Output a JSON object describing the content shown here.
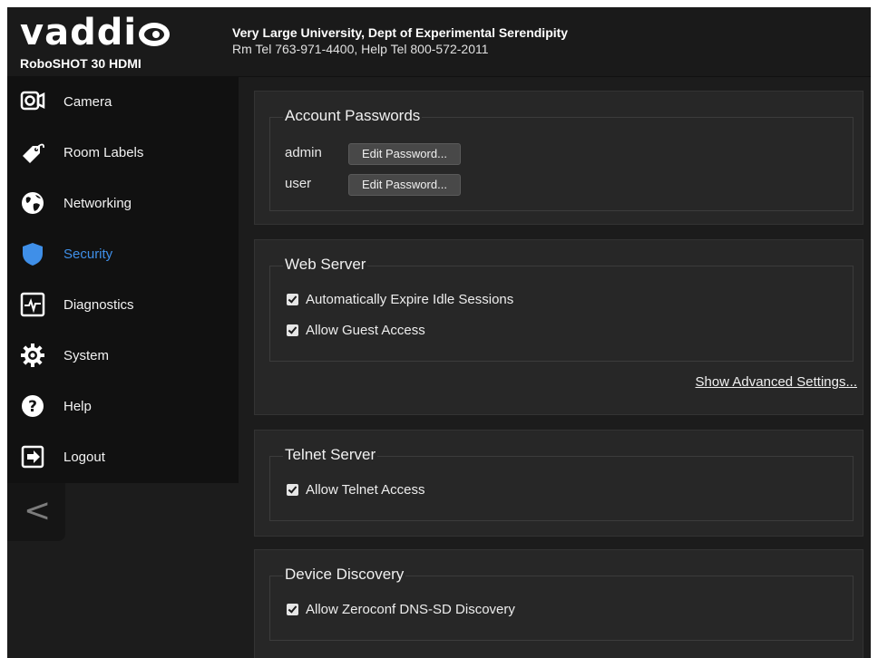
{
  "header": {
    "logo": "vaddio",
    "model": "RoboSHOT 30 HDMI",
    "org_name": "Very Large University, Dept of Experimental Serendipity",
    "phones": "Rm Tel 763-971-4400, Help Tel 800-572-2011"
  },
  "sidebar": {
    "items": [
      {
        "label": "Camera",
        "icon": "camera-icon"
      },
      {
        "label": "Room Labels",
        "icon": "tag-icon"
      },
      {
        "label": "Networking",
        "icon": "globe-icon"
      },
      {
        "label": "Security",
        "icon": "shield-icon",
        "active": true
      },
      {
        "label": "Diagnostics",
        "icon": "pulse-icon"
      },
      {
        "label": "System",
        "icon": "gear-icon"
      },
      {
        "label": "Help",
        "icon": "question-icon"
      },
      {
        "label": "Logout",
        "icon": "logout-icon"
      }
    ],
    "collapse_glyph": "<"
  },
  "account_passwords": {
    "title": "Account Passwords",
    "rows": [
      {
        "user": "admin",
        "button": "Edit Password..."
      },
      {
        "user": "user",
        "button": "Edit Password..."
      }
    ]
  },
  "web_server": {
    "title": "Web Server",
    "options": [
      {
        "label": "Automatically Expire Idle Sessions",
        "checked": true
      },
      {
        "label": "Allow Guest Access",
        "checked": true
      }
    ],
    "advanced_link": "Show Advanced Settings..."
  },
  "telnet_server": {
    "title": "Telnet Server",
    "options": [
      {
        "label": "Allow Telnet Access",
        "checked": true
      }
    ]
  },
  "device_discovery": {
    "title": "Device Discovery",
    "options": [
      {
        "label": "Allow Zeroconf DNS-SD Discovery",
        "checked": true
      }
    ]
  },
  "colors": {
    "active_nav": "#3f8fe8",
    "background": "#1c1c1c",
    "panel": "#272727"
  }
}
